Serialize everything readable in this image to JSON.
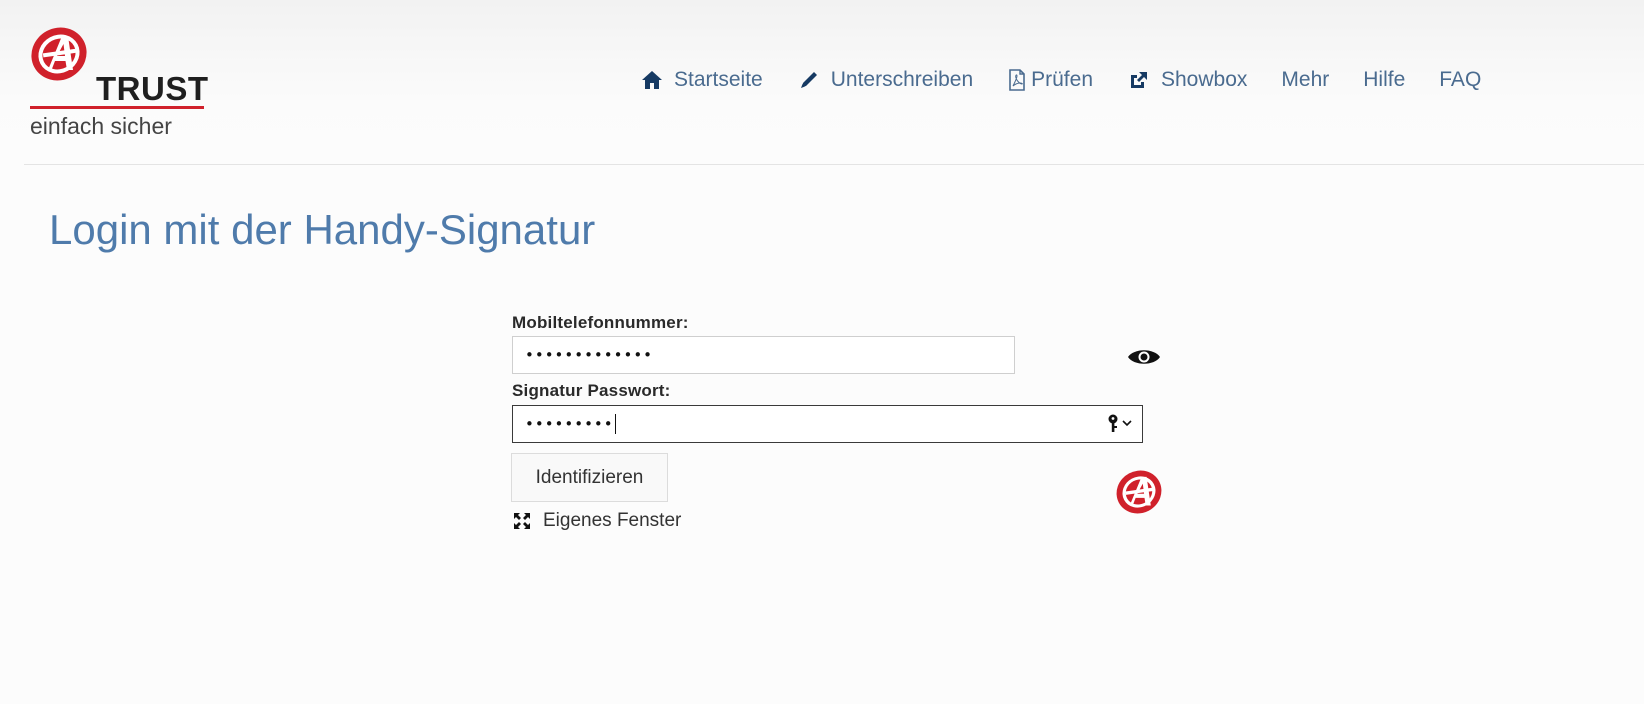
{
  "brand": {
    "word": "TRUST",
    "tagline": "einfach sicher",
    "accent_color": "#d0212b"
  },
  "nav": {
    "items": [
      {
        "label": "Startseite",
        "icon": "home-icon"
      },
      {
        "label": "Unterschreiben",
        "icon": "pencil-icon"
      },
      {
        "label": "Prüfen",
        "icon": "pdf-file-icon"
      },
      {
        "label": "Showbox",
        "icon": "external-link-icon"
      },
      {
        "label": "Mehr"
      },
      {
        "label": "Hilfe"
      },
      {
        "label": "FAQ"
      }
    ],
    "color": "#4a6b8f"
  },
  "main": {
    "title": "Login mit der Handy-Signatur",
    "title_color": "#4f7bab"
  },
  "form": {
    "phone_label": "Mobiltelefonnummer:",
    "phone_value": "•••••••••••••",
    "password_label": "Signatur Passwort:",
    "password_value": "•••••••••",
    "show_phone_icon": "eye-icon",
    "password_manager_icon": "key-icon",
    "submit_label": "Identifizieren",
    "own_window_label": "Eigenes Fenster",
    "own_window_icon": "expand-icon"
  }
}
